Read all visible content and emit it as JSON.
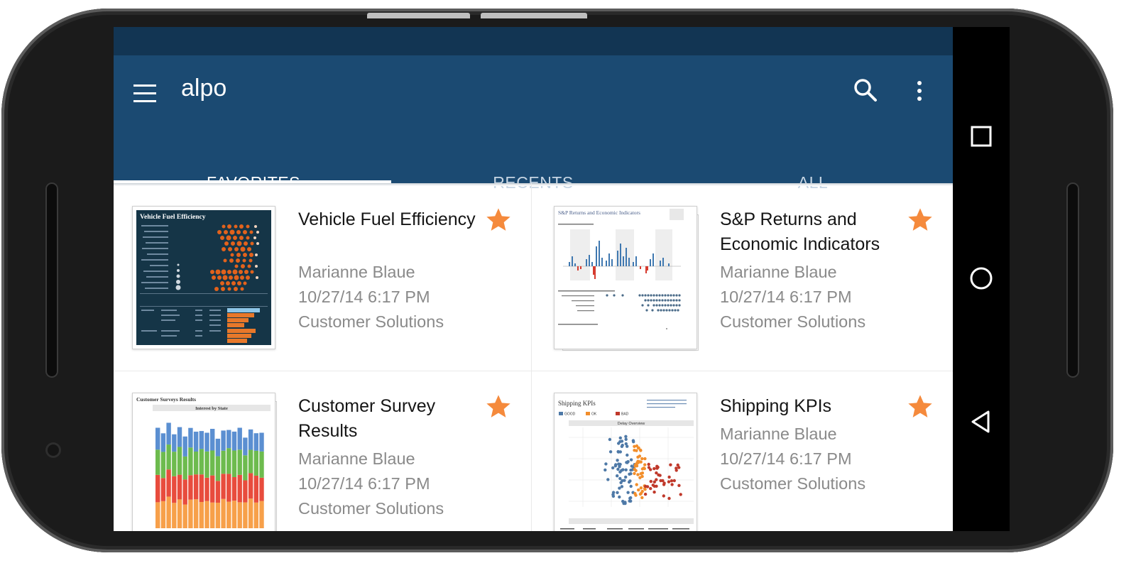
{
  "app": {
    "title": "alpo"
  },
  "toolbar": {
    "menu_icon": "hamburger-menu-icon",
    "search_icon": "search-icon",
    "more_icon": "more-vertical-icon"
  },
  "tabs": [
    {
      "label": "FAVORITES",
      "active": true
    },
    {
      "label": "RECENTS",
      "active": false
    },
    {
      "label": "ALL",
      "active": false
    }
  ],
  "cards": [
    {
      "title": "Vehicle Fuel Efficiency",
      "author": "Marianne Blaue",
      "date": "10/27/14 6:17 PM",
      "project": "Customer Solutions",
      "favorite": true,
      "thumb_title": "Vehicle Fuel Efficiency"
    },
    {
      "title": "S&P Returns and Economic Indicators",
      "author": "Marianne Blaue",
      "date": "10/27/14 6:17 PM",
      "project": "Customer Solutions",
      "favorite": true,
      "thumb_title": "S&P Returns and Economic Indicators"
    },
    {
      "title": "Customer Survey Results",
      "author": "Marianne Blaue",
      "date": "10/27/14 6:17 PM",
      "project": "Customer Solutions",
      "favorite": true,
      "thumb_title": "Customer Surveys Results",
      "thumb_subtitle": "Interest by State"
    },
    {
      "title": "Shipping KPIs",
      "author": "Marianne Blaue",
      "date": "10/27/14 6:17 PM",
      "project": "Customer Solutions",
      "favorite": true,
      "thumb_title": "Shipping KPIs",
      "thumb_legend": [
        "GOOD",
        "OK",
        "BAD"
      ],
      "thumb_subtitle": "Delay Overview"
    }
  ],
  "colors": {
    "statusbar": "#123553",
    "toolbar": "#1b4a72",
    "star": "#f58a3c",
    "meta_text": "#8a8a8a"
  },
  "nav": {
    "recent_icon": "square-recents-icon",
    "home_icon": "circle-home-icon",
    "back_icon": "triangle-back-icon"
  }
}
